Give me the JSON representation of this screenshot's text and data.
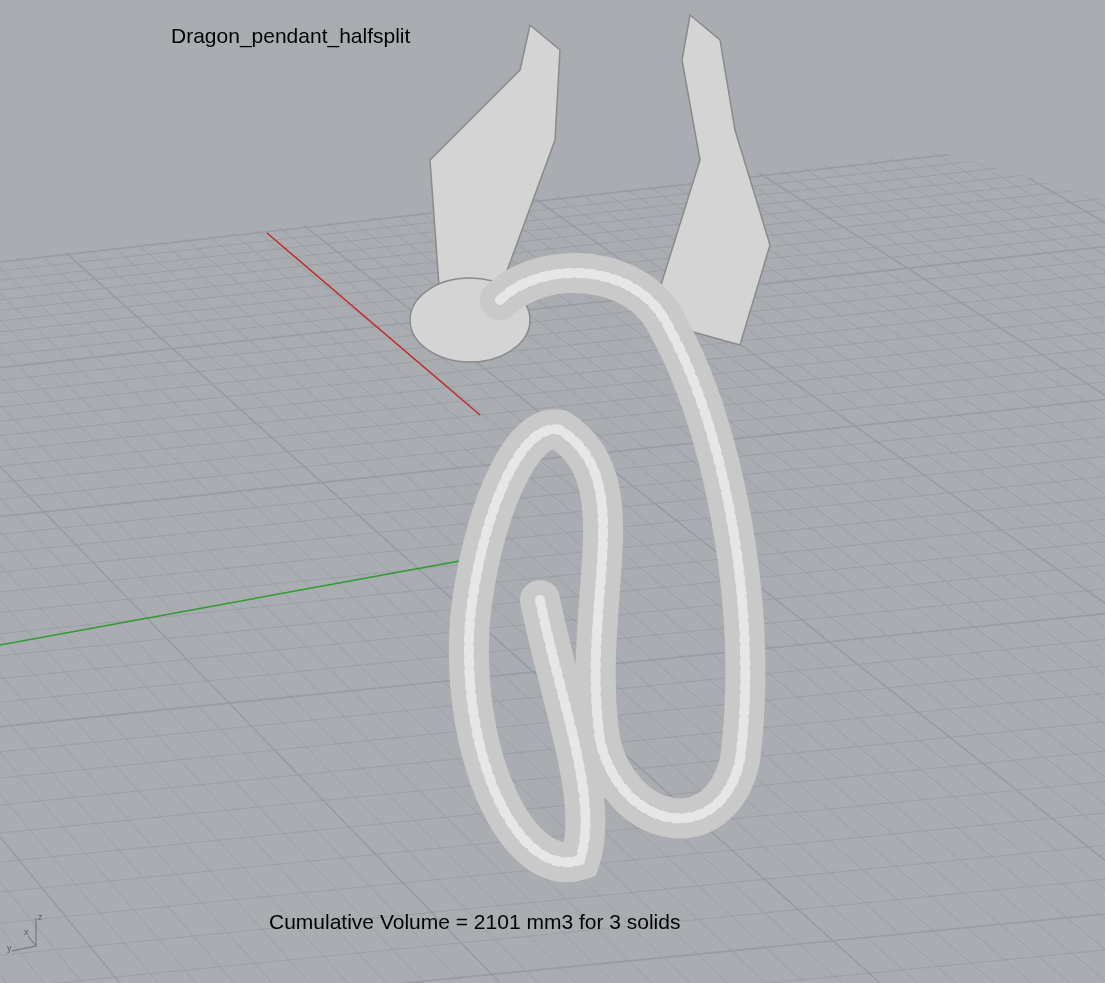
{
  "viewport": {
    "title": "Dragon_pendant_halfsplit",
    "caption": "Cumulative Volume = 2101 mm3 for 3 solids",
    "axis_labels": [
      "z",
      "x",
      "y"
    ]
  }
}
